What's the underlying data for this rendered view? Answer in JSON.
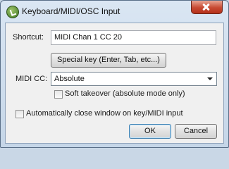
{
  "window": {
    "title": "Keyboard/MIDI/OSC Input"
  },
  "shortcut": {
    "label": "Shortcut:",
    "value": "MIDI Chan 1 CC 20"
  },
  "special_key_button": "Special key (Enter, Tab, etc...)",
  "midi_cc": {
    "label": "MIDI CC:",
    "selected": "Absolute"
  },
  "soft_takeover": {
    "label": "Soft takeover (absolute mode only)",
    "checked": false
  },
  "auto_close": {
    "label": "Automatically close window on key/MIDI input",
    "checked": false
  },
  "buttons": {
    "ok": "OK",
    "cancel": "Cancel"
  }
}
